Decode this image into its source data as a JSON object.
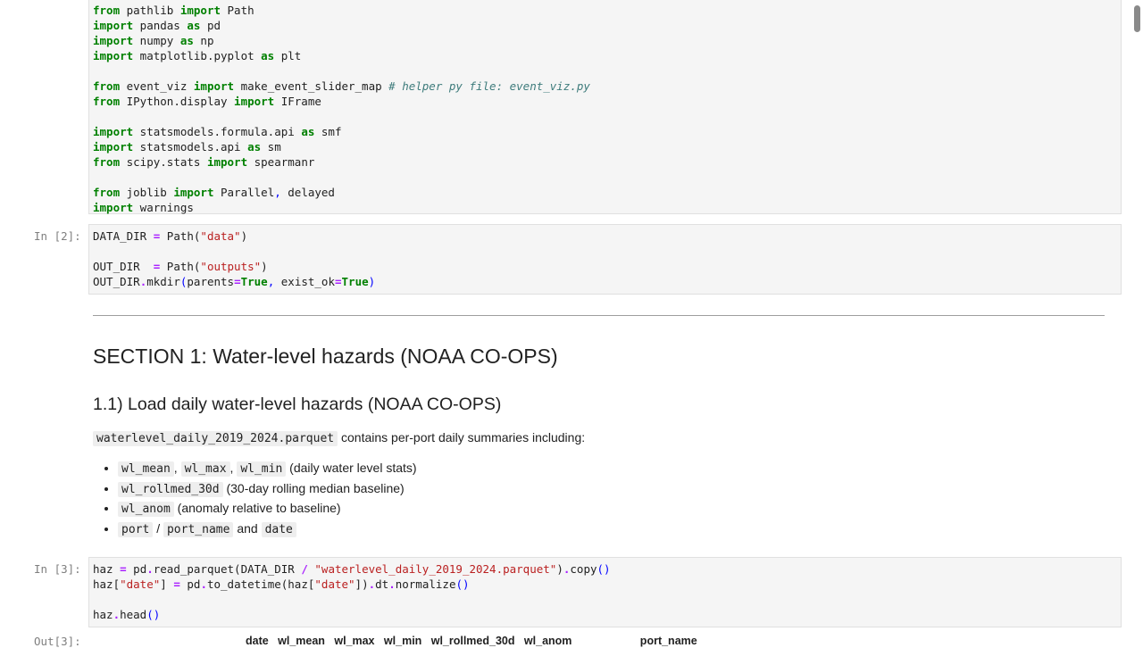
{
  "cells": {
    "imports": {
      "prompt": ""
    },
    "cell2": {
      "prompt": "In [2]:"
    },
    "cell3": {
      "prompt": "In [3]:"
    }
  },
  "code_tokens": {
    "c1_l1_a": "from",
    "c1_l1_b": " pathlib ",
    "c1_l1_c": "import",
    "c1_l1_d": " Path",
    "c1_l2_a": "import",
    "c1_l2_b": " pandas ",
    "c1_l2_c": "as",
    "c1_l2_d": " pd",
    "c1_l3_a": "import",
    "c1_l3_b": " numpy ",
    "c1_l3_c": "as",
    "c1_l3_d": " np",
    "c1_l4_a": "import",
    "c1_l4_b": " matplotlib.pyplot ",
    "c1_l4_c": "as",
    "c1_l4_d": " plt",
    "c1_l6_a": "from",
    "c1_l6_b": " event_viz ",
    "c1_l6_c": "import",
    "c1_l6_d": " make_event_slider_map ",
    "c1_l6_e": "# helper py file: event_viz.py",
    "c1_l7_a": "from",
    "c1_l7_b": " IPython.display ",
    "c1_l7_c": "import",
    "c1_l7_d": " IFrame",
    "c1_l9_a": "import",
    "c1_l9_b": " statsmodels.formula.api ",
    "c1_l9_c": "as",
    "c1_l9_d": " smf",
    "c1_l10_a": "import",
    "c1_l10_b": " statsmodels.api ",
    "c1_l10_c": "as",
    "c1_l10_d": " sm",
    "c1_l11_a": "from",
    "c1_l11_b": " scipy.stats ",
    "c1_l11_c": "import",
    "c1_l11_d": " spearmanr",
    "c1_l13_a": "from",
    "c1_l13_b": " joblib ",
    "c1_l13_c": "import",
    "c1_l13_d": " Parallel",
    "c1_l13_e": ",",
    "c1_l13_f": " delayed",
    "c1_l14_a": "import",
    "c1_l14_b": " warnings",
    "c2_l1_a": "DATA_DIR ",
    "c2_l1_b": "=",
    "c2_l1_c": " Path(",
    "c2_l1_d": "\"data\"",
    "c2_l1_e": ")",
    "c2_l3_a": "OUT_DIR  ",
    "c2_l3_b": "=",
    "c2_l3_c": " Path(",
    "c2_l3_d": "\"outputs\"",
    "c2_l3_e": ")",
    "c2_l4_a": "OUT_DIR",
    "c2_l4_b": ".",
    "c2_l4_c": "mkdir",
    "c2_l4_d": "(",
    "c2_l4_e": "parents",
    "c2_l4_f": "=",
    "c2_l4_g": "True",
    "c2_l4_h": ",",
    "c2_l4_i": " exist_ok",
    "c2_l4_j": "=",
    "c2_l4_k": "True",
    "c2_l4_l": ")",
    "c3_l1_a": "haz ",
    "c3_l1_b": "=",
    "c3_l1_c": " pd",
    "c3_l1_d": ".",
    "c3_l1_e": "read_parquet(DATA_DIR ",
    "c3_l1_f": "/",
    "c3_l1_g": " ",
    "c3_l1_h": "\"waterlevel_daily_2019_2024.parquet\"",
    "c3_l1_i": ")",
    "c3_l1_j": ".",
    "c3_l1_k": "copy",
    "c3_l1_l": "()",
    "c3_l2_a": "haz[",
    "c3_l2_b": "\"date\"",
    "c3_l2_c": "] ",
    "c3_l2_d": "=",
    "c3_l2_e": " pd",
    "c3_l2_f": ".",
    "c3_l2_g": "to_datetime(haz[",
    "c3_l2_h": "\"date\"",
    "c3_l2_i": "])",
    "c3_l2_j": ".",
    "c3_l2_k": "dt",
    "c3_l2_l": ".",
    "c3_l2_m": "normalize",
    "c3_l2_n": "()",
    "c3_l4_a": "haz",
    "c3_l4_b": ".",
    "c3_l4_c": "head",
    "c3_l4_d": "()"
  },
  "markdown": {
    "section_title": "SECTION 1: Water-level hazards (NOAA CO-OPS)",
    "subsection_title": "1.1) Load daily water-level hazards (NOAA CO-OPS)",
    "intro_code": "waterlevel_daily_2019_2024.parquet",
    "intro_text": " contains per-port daily summaries including:",
    "bullets": [
      {
        "codes": [
          "wl_mean",
          "wl_max",
          "wl_min"
        ],
        "seps": [
          ", ",
          ", "
        ],
        "text": " (daily water level stats)"
      },
      {
        "codes": [
          "wl_rollmed_30d"
        ],
        "text": " (30-day rolling median baseline)"
      },
      {
        "codes": [
          "wl_anom"
        ],
        "text": " (anomaly relative to baseline)"
      },
      {
        "codes": [
          "port",
          "port_name",
          "date"
        ],
        "seps": [
          " / ",
          " and "
        ],
        "text": ""
      }
    ]
  },
  "output": {
    "prompt": "Out[3]:",
    "headers": "date   wl_mean   wl_max   wl_min   wl_rollmed_30d   wl_anom                      port_name"
  }
}
